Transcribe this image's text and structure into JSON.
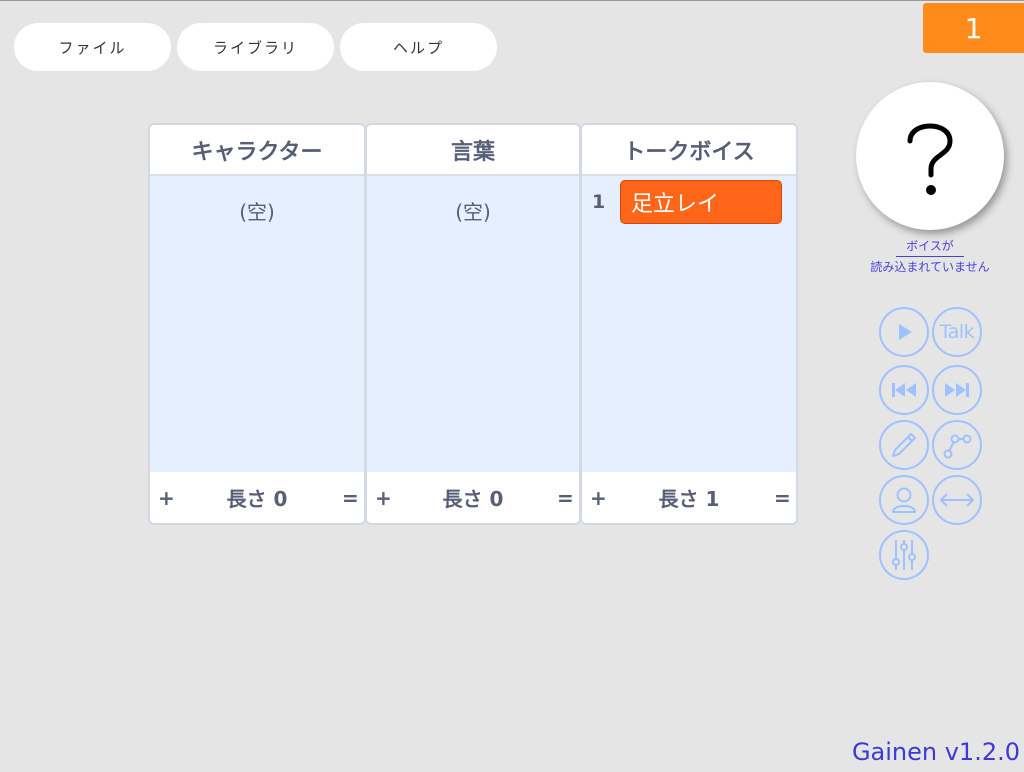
{
  "menu": {
    "file": "ファイル",
    "library": "ライブラリ",
    "help": "ヘルプ"
  },
  "counter": "1",
  "columns": {
    "character": {
      "header": "キャラクター",
      "empty": "(空)",
      "plus": "+",
      "length": "長さ 0",
      "equals": "="
    },
    "word": {
      "header": "言葉",
      "empty": "(空)",
      "plus": "+",
      "length": "長さ 0",
      "equals": "="
    },
    "voice": {
      "header": "トークボイス",
      "items": [
        {
          "index": "1",
          "name": "足立レイ"
        }
      ],
      "plus": "+",
      "length": "長さ 1",
      "equals": "="
    }
  },
  "help_mark": "?",
  "voice_status": {
    "line1": "ボイスが",
    "line2": "読み込まれていません"
  },
  "controls": {
    "talk_label": "Talk"
  },
  "icons": {
    "play": "play-icon",
    "rewind": "rewind-icon",
    "fast_forward": "fast-forward-icon",
    "pencil": "pencil-icon",
    "path": "path-icon",
    "person": "person-icon",
    "width": "double-arrow-icon",
    "sliders": "sliders-icon"
  },
  "colors": {
    "background": "#e5e5e5",
    "counter": "#ff8c1a",
    "voice_block": "#ff661a",
    "control_outline": "#9ec1ff",
    "status_text": "#4c3fd8"
  },
  "version": "Gainen v1.2.0"
}
